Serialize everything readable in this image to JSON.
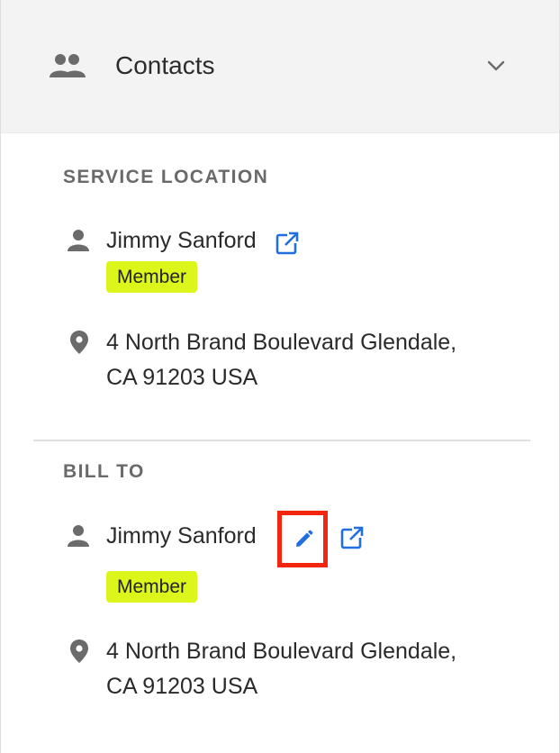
{
  "header": {
    "title": "Contacts",
    "icon": "people-icon",
    "toggle_icon": "chevron-down-icon"
  },
  "service_location": {
    "label": "SERVICE LOCATION",
    "contact_name": "Jimmy Sanford",
    "badge": "Member",
    "address_line1": "4 North Brand Boulevard Glendale,",
    "address_line2": "CA 91203 USA"
  },
  "bill_to": {
    "label": "BILL TO",
    "contact_name": "Jimmy Sanford",
    "badge": "Member",
    "address_line1": "4 North Brand Boulevard Glendale,",
    "address_line2": "CA 91203 USA"
  },
  "colors": {
    "badge_bg": "#dcf51b",
    "link_blue": "#1f6fe0",
    "highlight_border": "#f2250f",
    "header_bg": "#f3f3f3"
  }
}
